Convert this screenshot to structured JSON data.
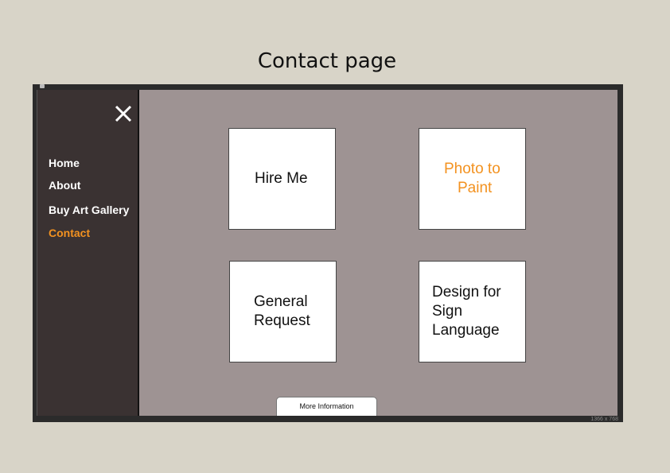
{
  "page_heading": "Contact page",
  "sidebar": {
    "items": [
      {
        "label": "Home",
        "active": false
      },
      {
        "label": "About",
        "active": false
      },
      {
        "label": "Buy Art Gallery",
        "active": false
      },
      {
        "label": "Contact",
        "active": true
      }
    ],
    "close_icon": "close-icon"
  },
  "tiles": {
    "hire_me": [
      "Hire Me"
    ],
    "photo_to_paint": [
      "Photo to",
      "Paint"
    ],
    "general_request": [
      "General",
      "Request"
    ],
    "sign_language": [
      "Design for",
      "Sign",
      "Language"
    ]
  },
  "more_info_label": "More Information",
  "resolution_label": "1366 x 768",
  "colors": {
    "background": "#d8d4c8",
    "screen": "#9e9393",
    "sidebar": "#3a3232",
    "accent": "#f39220"
  }
}
